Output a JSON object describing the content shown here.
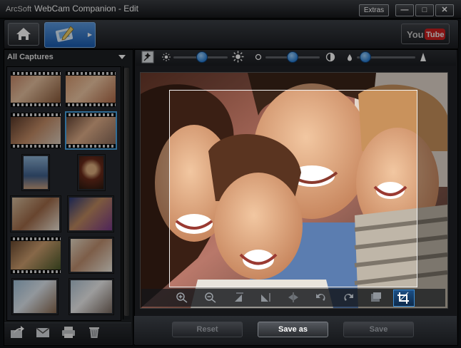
{
  "window": {
    "brand": "ArcSoft",
    "title": "WebCam Companion - Edit",
    "extras_label": "Extras",
    "minimize_label": "—",
    "maximize_label": "□",
    "close_label": "✕"
  },
  "nav": {
    "home_icon": "home-icon",
    "edit_icon": "edit-tools-icon",
    "youtube_label_you": "You",
    "youtube_label_tube": "Tube"
  },
  "captures": {
    "dropdown_label": "All Captures",
    "thumbnails": [
      {
        "kind": "video",
        "selected": false
      },
      {
        "kind": "video",
        "selected": false
      },
      {
        "kind": "video",
        "selected": false
      },
      {
        "kind": "video",
        "selected": true
      },
      {
        "kind": "photo",
        "selected": false
      },
      {
        "kind": "photo",
        "selected": false
      },
      {
        "kind": "photo",
        "selected": false
      },
      {
        "kind": "photo",
        "selected": false
      },
      {
        "kind": "video",
        "selected": false
      },
      {
        "kind": "photo",
        "selected": false
      },
      {
        "kind": "photo",
        "selected": false
      },
      {
        "kind": "photo",
        "selected": false
      }
    ]
  },
  "left_toolbar": {
    "icons": [
      "share-icon",
      "email-icon",
      "print-icon",
      "delete-icon"
    ]
  },
  "adjustments": {
    "brightness": 0.52,
    "contrast": 0.5,
    "sharpness": 0.15
  },
  "edit_tools": {
    "icons": [
      "zoom-in-icon",
      "zoom-out-icon",
      "flip-horizontal-icon",
      "flip-vertical-icon",
      "mirror-icon",
      "rotate-left-icon",
      "rotate-right-icon",
      "frame-icon",
      "crop-icon"
    ]
  },
  "actions": {
    "reset_label": "Reset",
    "save_as_label": "Save as",
    "save_label": "Save"
  },
  "colors": {
    "accent": "#2b7fd4",
    "youtube_red": "#cc1f1f"
  }
}
